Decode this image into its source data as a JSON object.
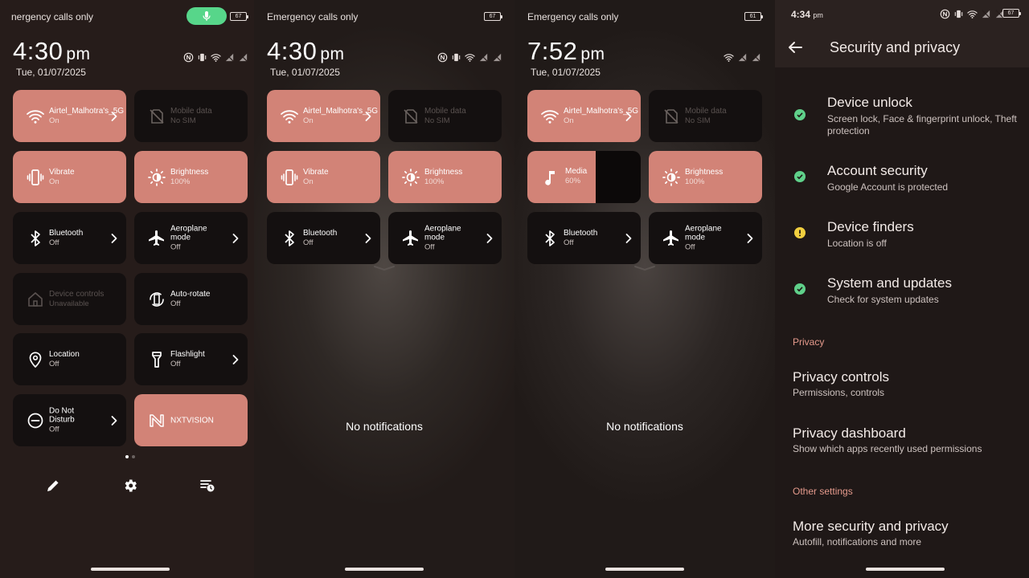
{
  "colors": {
    "tile_on": "#d28377",
    "tile_off": "#141010",
    "mic_pill": "#57d68a",
    "ok": "#5fd08a",
    "warn": "#f1cf3f",
    "section": "#e59a8c"
  },
  "panel1": {
    "carrier": "nergency calls only",
    "battery": "67",
    "clock": "4:30",
    "ampm": "pm",
    "date": "Tue, 01/07/2025",
    "tiles": {
      "wifi": {
        "label": "Airtel_Malhotra's_5G",
        "sub": "On"
      },
      "mobile": {
        "label": "Mobile data",
        "sub": "No SIM"
      },
      "vibrate": {
        "label": "Vibrate",
        "sub": "On"
      },
      "brightness": {
        "label": "Brightness",
        "sub": "100%"
      },
      "bluetooth": {
        "label": "Bluetooth",
        "sub": "Off"
      },
      "aeroplane": {
        "label": "Aeroplane mode",
        "sub": "Off"
      },
      "device": {
        "label": "Device controls",
        "sub": "Unavailable"
      },
      "rotate": {
        "label": "Auto-rotate",
        "sub": "Off"
      },
      "location": {
        "label": "Location",
        "sub": "Off"
      },
      "flashlight": {
        "label": "Flashlight",
        "sub": "Off"
      },
      "dnd": {
        "label": "Do Not Disturb",
        "sub": "Off"
      },
      "nxt": {
        "label": "NXTVISION"
      }
    }
  },
  "panel2": {
    "carrier": "Emergency calls only",
    "battery": "67",
    "clock": "4:30",
    "ampm": "pm",
    "date": "Tue, 01/07/2025",
    "tiles": {
      "wifi": {
        "label": "Airtel_Malhotra's_5G",
        "sub": "On"
      },
      "mobile": {
        "label": "Mobile data",
        "sub": "No SIM"
      },
      "vibrate": {
        "label": "Vibrate",
        "sub": "On"
      },
      "brightness": {
        "label": "Brightness",
        "sub": "100%"
      },
      "bluetooth": {
        "label": "Bluetooth",
        "sub": "Off"
      },
      "aeroplane": {
        "label": "Aeroplane mode",
        "sub": "Off"
      }
    },
    "notifications": "No notifications"
  },
  "panel3": {
    "carrier": "Emergency calls only",
    "battery": "61",
    "clock": "7:52",
    "ampm": "pm",
    "date": "Tue, 01/07/2025",
    "tiles": {
      "wifi": {
        "label": "Airtel_Malhotra's_5G",
        "sub": "On"
      },
      "mobile": {
        "label": "Mobile data",
        "sub": "No SIM"
      },
      "media": {
        "label": "Media",
        "sub": "60%",
        "level": 0.6
      },
      "brightness": {
        "label": "Brightness",
        "sub": "100%"
      },
      "bluetooth": {
        "label": "Bluetooth",
        "sub": "Off"
      },
      "aeroplane": {
        "label": "Aeroplane mode",
        "sub": "Off"
      }
    },
    "notifications": "No notifications"
  },
  "panel4": {
    "time": "4:34",
    "ampm": "pm",
    "battery": "67",
    "title": "Security and privacy",
    "items": [
      {
        "title": "Device unlock",
        "sub": "Screen lock, Face & fingerprint unlock, Theft protection",
        "status": "ok"
      },
      {
        "title": "Account security",
        "sub": "Google Account is protected",
        "status": "ok"
      },
      {
        "title": "Device finders",
        "sub": "Location is off",
        "status": "warn"
      },
      {
        "title": "System and updates",
        "sub": "Check for system updates",
        "status": "ok"
      }
    ],
    "sections": {
      "privacy": "Privacy",
      "other": "Other settings"
    },
    "privacy_items": [
      {
        "title": "Privacy controls",
        "sub": "Permissions, controls"
      },
      {
        "title": "Privacy dashboard",
        "sub": "Show which apps recently used permissions"
      }
    ],
    "other_items": [
      {
        "title": "More security and privacy",
        "sub": "Autofill, notifications and more"
      }
    ]
  }
}
